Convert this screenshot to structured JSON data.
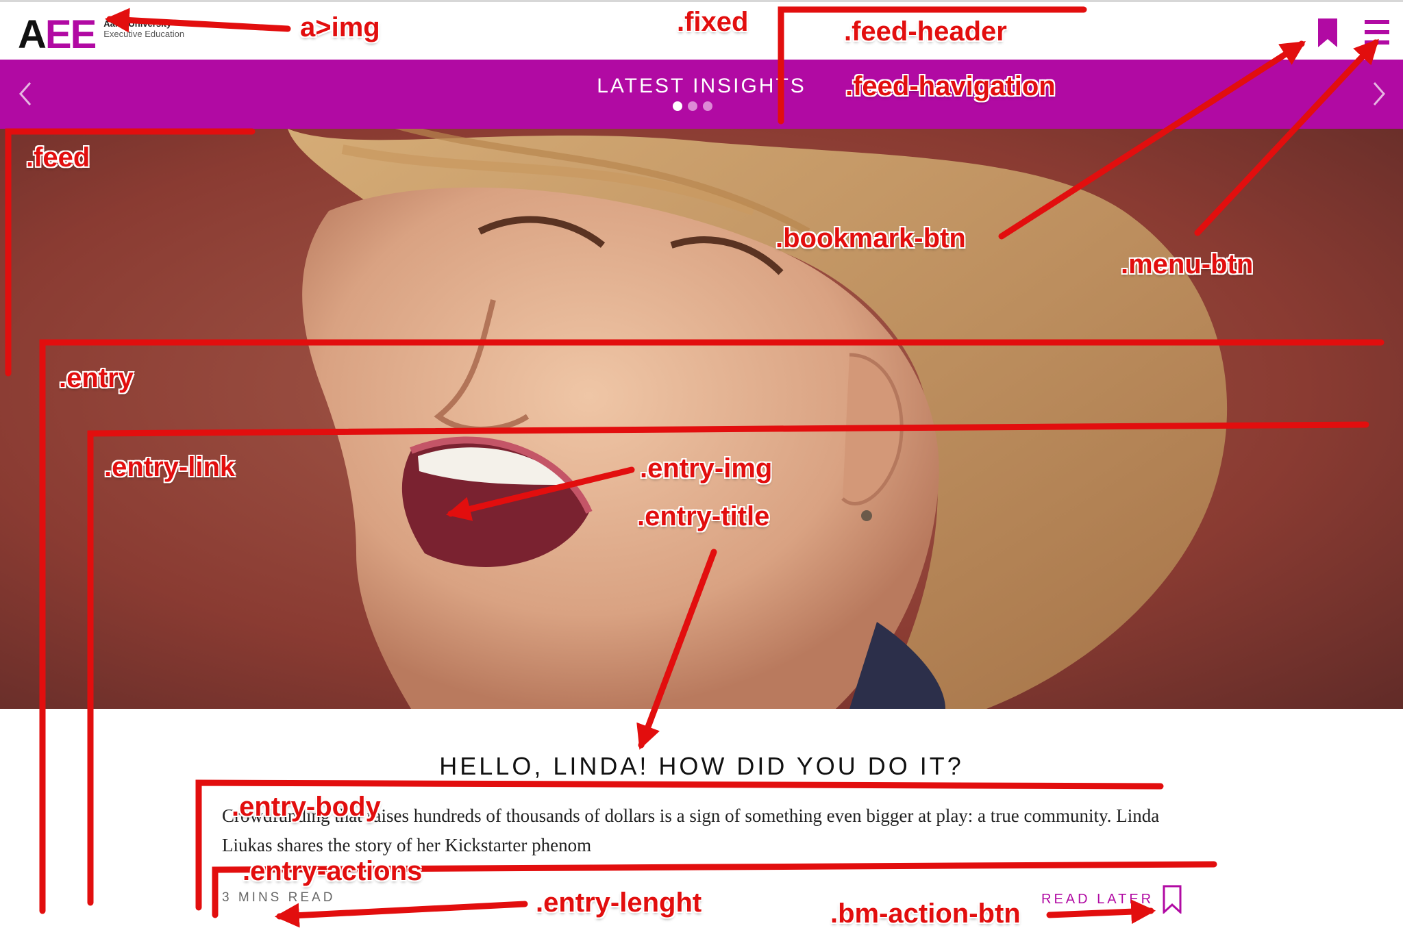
{
  "header": {
    "logo_mark_a": "A",
    "logo_mark_ee": "EE",
    "logo_line1": "Aalto University",
    "logo_line2": "Executive Education",
    "bookmark_icon": "bookmark-icon",
    "menu_icon": "hamburger-menu-icon"
  },
  "navigation": {
    "title": "LATEST INSIGHTS",
    "dots_count": 3,
    "active_dot": 1,
    "prev_icon": "chevron-left-icon",
    "next_icon": "chevron-right-icon"
  },
  "entry": {
    "title": "HELLO, LINDA! HOW DID YOU DO IT?",
    "body": "Crowdfunding that raises hundreds of thousands of dollars is a sign of something even bigger at play: a true community. Linda Liukas shares the story of her Kickstarter phenom",
    "length": "3 MINS READ",
    "read_later": "READ LATER"
  },
  "annotations": {
    "a_img": "a>img",
    "fixed": ".fixed",
    "feed_header": ".feed-header",
    "feed_navigation": ".feed-havigation",
    "feed": ".feed",
    "bookmark_btn": ".bookmark-btn",
    "menu_btn": ".menu-btn",
    "entry": ".entry",
    "entry_link": ".entry-link",
    "entry_img": ".entry-img",
    "entry_title": ".entry-title",
    "entry_body": ".entry-body",
    "entry_actions": ".entry-actions",
    "entry_length": ".entry-lenght",
    "bm_action_btn": ".bm-action-btn"
  },
  "colors": {
    "brand": "#b10aa3",
    "annotation": "#e20e0e"
  }
}
